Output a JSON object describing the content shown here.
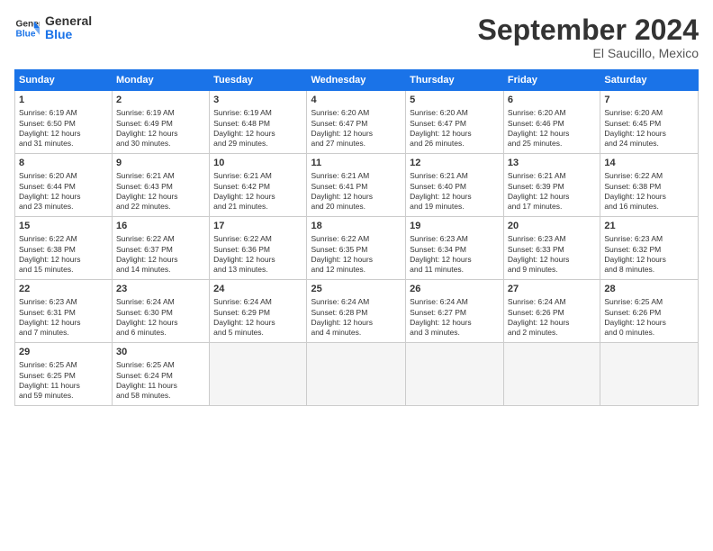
{
  "logo": {
    "line1": "General",
    "line2": "Blue"
  },
  "title": "September 2024",
  "subtitle": "El Saucillo, Mexico",
  "days_of_week": [
    "Sunday",
    "Monday",
    "Tuesday",
    "Wednesday",
    "Thursday",
    "Friday",
    "Saturday"
  ],
  "weeks": [
    [
      {
        "day": "1",
        "detail": "Sunrise: 6:19 AM\nSunset: 6:50 PM\nDaylight: 12 hours\nand 31 minutes."
      },
      {
        "day": "2",
        "detail": "Sunrise: 6:19 AM\nSunset: 6:49 PM\nDaylight: 12 hours\nand 30 minutes."
      },
      {
        "day": "3",
        "detail": "Sunrise: 6:19 AM\nSunset: 6:48 PM\nDaylight: 12 hours\nand 29 minutes."
      },
      {
        "day": "4",
        "detail": "Sunrise: 6:20 AM\nSunset: 6:47 PM\nDaylight: 12 hours\nand 27 minutes."
      },
      {
        "day": "5",
        "detail": "Sunrise: 6:20 AM\nSunset: 6:47 PM\nDaylight: 12 hours\nand 26 minutes."
      },
      {
        "day": "6",
        "detail": "Sunrise: 6:20 AM\nSunset: 6:46 PM\nDaylight: 12 hours\nand 25 minutes."
      },
      {
        "day": "7",
        "detail": "Sunrise: 6:20 AM\nSunset: 6:45 PM\nDaylight: 12 hours\nand 24 minutes."
      }
    ],
    [
      {
        "day": "8",
        "detail": "Sunrise: 6:20 AM\nSunset: 6:44 PM\nDaylight: 12 hours\nand 23 minutes."
      },
      {
        "day": "9",
        "detail": "Sunrise: 6:21 AM\nSunset: 6:43 PM\nDaylight: 12 hours\nand 22 minutes."
      },
      {
        "day": "10",
        "detail": "Sunrise: 6:21 AM\nSunset: 6:42 PM\nDaylight: 12 hours\nand 21 minutes."
      },
      {
        "day": "11",
        "detail": "Sunrise: 6:21 AM\nSunset: 6:41 PM\nDaylight: 12 hours\nand 20 minutes."
      },
      {
        "day": "12",
        "detail": "Sunrise: 6:21 AM\nSunset: 6:40 PM\nDaylight: 12 hours\nand 19 minutes."
      },
      {
        "day": "13",
        "detail": "Sunrise: 6:21 AM\nSunset: 6:39 PM\nDaylight: 12 hours\nand 17 minutes."
      },
      {
        "day": "14",
        "detail": "Sunrise: 6:22 AM\nSunset: 6:38 PM\nDaylight: 12 hours\nand 16 minutes."
      }
    ],
    [
      {
        "day": "15",
        "detail": "Sunrise: 6:22 AM\nSunset: 6:38 PM\nDaylight: 12 hours\nand 15 minutes."
      },
      {
        "day": "16",
        "detail": "Sunrise: 6:22 AM\nSunset: 6:37 PM\nDaylight: 12 hours\nand 14 minutes."
      },
      {
        "day": "17",
        "detail": "Sunrise: 6:22 AM\nSunset: 6:36 PM\nDaylight: 12 hours\nand 13 minutes."
      },
      {
        "day": "18",
        "detail": "Sunrise: 6:22 AM\nSunset: 6:35 PM\nDaylight: 12 hours\nand 12 minutes."
      },
      {
        "day": "19",
        "detail": "Sunrise: 6:23 AM\nSunset: 6:34 PM\nDaylight: 12 hours\nand 11 minutes."
      },
      {
        "day": "20",
        "detail": "Sunrise: 6:23 AM\nSunset: 6:33 PM\nDaylight: 12 hours\nand 9 minutes."
      },
      {
        "day": "21",
        "detail": "Sunrise: 6:23 AM\nSunset: 6:32 PM\nDaylight: 12 hours\nand 8 minutes."
      }
    ],
    [
      {
        "day": "22",
        "detail": "Sunrise: 6:23 AM\nSunset: 6:31 PM\nDaylight: 12 hours\nand 7 minutes."
      },
      {
        "day": "23",
        "detail": "Sunrise: 6:24 AM\nSunset: 6:30 PM\nDaylight: 12 hours\nand 6 minutes."
      },
      {
        "day": "24",
        "detail": "Sunrise: 6:24 AM\nSunset: 6:29 PM\nDaylight: 12 hours\nand 5 minutes."
      },
      {
        "day": "25",
        "detail": "Sunrise: 6:24 AM\nSunset: 6:28 PM\nDaylight: 12 hours\nand 4 minutes."
      },
      {
        "day": "26",
        "detail": "Sunrise: 6:24 AM\nSunset: 6:27 PM\nDaylight: 12 hours\nand 3 minutes."
      },
      {
        "day": "27",
        "detail": "Sunrise: 6:24 AM\nSunset: 6:26 PM\nDaylight: 12 hours\nand 2 minutes."
      },
      {
        "day": "28",
        "detail": "Sunrise: 6:25 AM\nSunset: 6:26 PM\nDaylight: 12 hours\nand 0 minutes."
      }
    ],
    [
      {
        "day": "29",
        "detail": "Sunrise: 6:25 AM\nSunset: 6:25 PM\nDaylight: 11 hours\nand 59 minutes."
      },
      {
        "day": "30",
        "detail": "Sunrise: 6:25 AM\nSunset: 6:24 PM\nDaylight: 11 hours\nand 58 minutes."
      },
      {
        "day": "",
        "detail": ""
      },
      {
        "day": "",
        "detail": ""
      },
      {
        "day": "",
        "detail": ""
      },
      {
        "day": "",
        "detail": ""
      },
      {
        "day": "",
        "detail": ""
      }
    ]
  ]
}
